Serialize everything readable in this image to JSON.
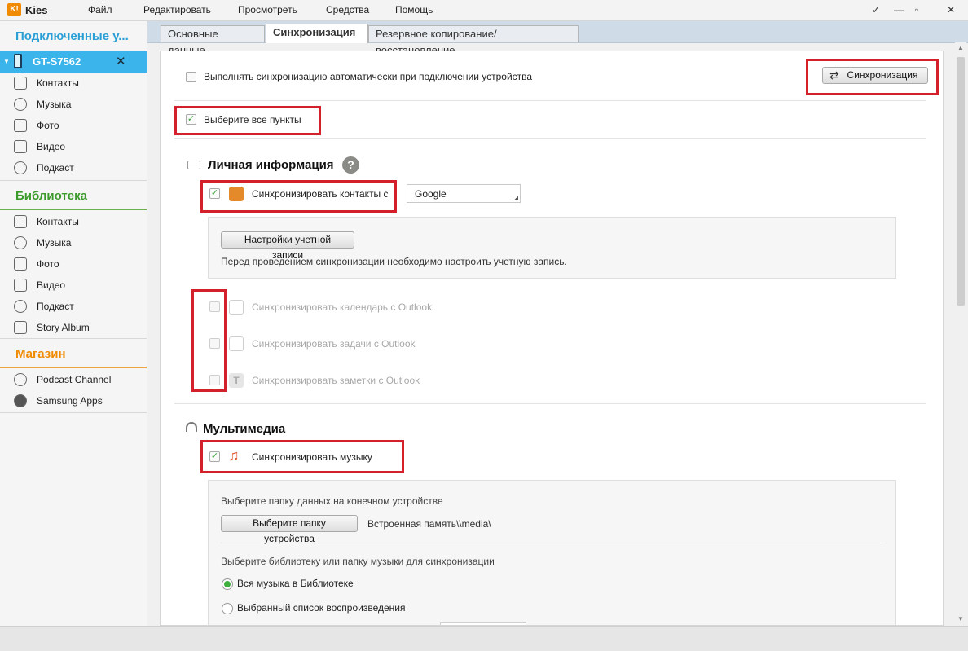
{
  "app": {
    "logo": "K!",
    "name": "Kies"
  },
  "menu": [
    "Файл",
    "Редактировать",
    "Просмотреть",
    "Средства",
    "Помощь"
  ],
  "window": {
    "pin": "✓",
    "minimize": "—",
    "maximize": "▫",
    "close": "✕"
  },
  "sidebar": {
    "connected_title": "Подключенные у...",
    "device": {
      "name": "GT-S7562",
      "close": "✕"
    },
    "device_items": [
      "Контакты",
      "Музыка",
      "Фото",
      "Видео",
      "Подкаст"
    ],
    "library_title": "Библиотека",
    "library_items": [
      "Контакты",
      "Музыка",
      "Фото",
      "Видео",
      "Подкаст",
      "Story Album"
    ],
    "store_title": "Магазин",
    "store_items": [
      "Podcast Channel",
      "Samsung Apps"
    ]
  },
  "tabs": [
    "Основные данные",
    "Синхронизация",
    "Резервное копирование/восстановление"
  ],
  "sync": {
    "auto_sync_label": "Выполнять синхронизацию автоматически при подключении устройства",
    "sync_button": "Синхронизация",
    "select_all": "Выберите все пункты",
    "personal": {
      "title": "Личная информация",
      "help": "?",
      "contacts_label": "Синхронизировать контакты с",
      "contacts_source": "Google",
      "account_button": "Настройки учетной записи",
      "account_note": "Перед проведением синхронизации необходимо настроить учетную запись.",
      "calendar": "Синхронизировать календарь с Outlook",
      "tasks": "Синхронизировать задачи с Outlook",
      "notes": "Синхронизировать заметки с Outlook"
    },
    "media": {
      "title": "Мультимедиа",
      "music_label": "Синхронизировать музыку",
      "folder_prompt": "Выберите папку данных на конечном устройстве",
      "folder_button": "Выберите папку устройства",
      "folder_path": "Встроенная память\\\\media\\",
      "library_prompt": "Выберите библиотеку или папку музыки для синхронизации",
      "all_music": "Вся музыка в Библиотеке",
      "playlist": "Выбранный список воспроизведения"
    }
  },
  "colors": {
    "accent_blue": "#3ab4ea",
    "library_green": "#3a9a2a",
    "store_orange": "#f08a00",
    "highlight_red": "#d4202a"
  }
}
